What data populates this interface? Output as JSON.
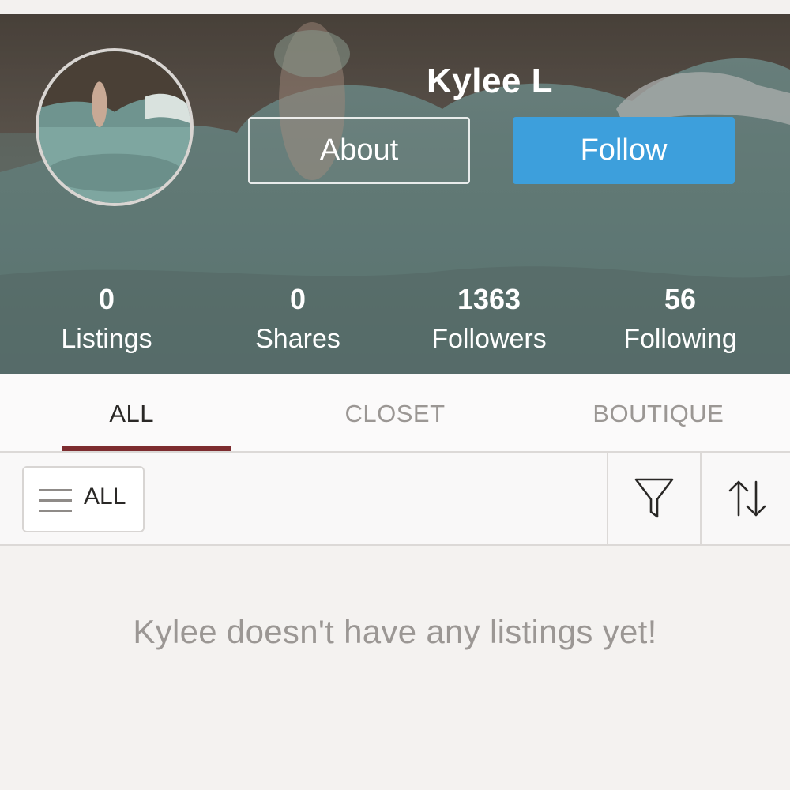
{
  "profile": {
    "name": "Kylee L",
    "about_label": "About",
    "follow_label": "Follow",
    "follow_color": "#3d9fdc"
  },
  "stats": [
    {
      "value": "0",
      "label": "Listings"
    },
    {
      "value": "0",
      "label": "Shares"
    },
    {
      "value": "1363",
      "label": "Followers"
    },
    {
      "value": "56",
      "label": "Following"
    }
  ],
  "tabs": [
    {
      "label": "ALL",
      "active": true
    },
    {
      "label": "CLOSET",
      "active": false
    },
    {
      "label": "BOUTIQUE",
      "active": false
    }
  ],
  "tab_accent_color": "#7d2c2f",
  "filter_bar": {
    "category_label": "ALL",
    "category_icon": "hamburger-menu-icon",
    "filter_icon": "funnel-icon",
    "sort_icon": "sort-arrows-icon"
  },
  "empty_state": {
    "message": "Kylee doesn't have any listings yet!"
  }
}
